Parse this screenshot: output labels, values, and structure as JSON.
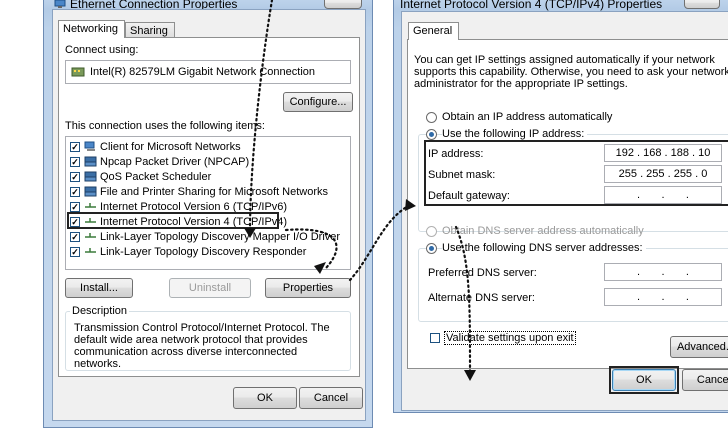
{
  "left_dialog": {
    "title": "Ethernet Connection Properties",
    "tabs": [
      "Networking",
      "Sharing"
    ],
    "connect_using_label": "Connect using:",
    "adapter_name": "Intel(R) 82579LM Gigabit Network Connection",
    "configure_label": "Configure...",
    "items_label": "This connection uses the following items:",
    "items": [
      {
        "label": "Client for Microsoft Networks",
        "checked": true,
        "icon": "network-client-icon"
      },
      {
        "label": "Npcap Packet Driver (NPCAP)",
        "checked": true,
        "icon": "network-service-icon"
      },
      {
        "label": "QoS Packet Scheduler",
        "checked": true,
        "icon": "network-service-icon"
      },
      {
        "label": "File and Printer Sharing for Microsoft Networks",
        "checked": true,
        "icon": "network-service-icon"
      },
      {
        "label": "Internet Protocol Version 6 (TCP/IPv6)",
        "checked": true,
        "icon": "protocol-icon"
      },
      {
        "label": "Internet Protocol Version 4 (TCP/IPv4)",
        "checked": true,
        "icon": "protocol-icon"
      },
      {
        "label": "Link-Layer Topology Discovery Mapper I/O Driver",
        "checked": true,
        "icon": "protocol-icon"
      },
      {
        "label": "Link-Layer Topology Discovery Responder",
        "checked": true,
        "icon": "protocol-icon"
      }
    ],
    "install_label": "Install...",
    "uninstall_label": "Uninstall",
    "properties_label": "Properties",
    "description_heading": "Description",
    "description_text": "Transmission Control Protocol/Internet Protocol. The default wide area network protocol that provides communication across diverse interconnected networks.",
    "ok_label": "OK",
    "cancel_label": "Cancel"
  },
  "right_dialog": {
    "title": "Internet Protocol Version 4 (TCP/IPv4) Properties",
    "tab": "General",
    "intro_text": "You can get IP settings assigned automatically if your network supports this capability. Otherwise, you need to ask your network administrator for the appropriate IP settings.",
    "obtain_ip_auto": "Obtain an IP address automatically",
    "use_following_ip": "Use the following IP address:",
    "ip_address_label": "IP address:",
    "ip_address_value": "192 . 168 . 188 . 10",
    "subnet_label": "Subnet mask:",
    "subnet_value": "255 . 255 . 255 . 0",
    "gateway_label": "Default gateway:",
    "gateway_value": ".       .       .",
    "obtain_dns_auto": "Obtain DNS server address automatically",
    "use_following_dns": "Use the following DNS server addresses:",
    "preferred_dns_label": "Preferred DNS server:",
    "preferred_dns_value": ".       .       .",
    "alternate_dns_label": "Alternate DNS server:",
    "alternate_dns_value": ".       .       .",
    "validate_label": "Validate settings upon exit",
    "advanced_label": "Advanced...",
    "ok_label": "OK",
    "cancel_label": "Cancel"
  },
  "colors": {
    "window_frame": "#bcd2ea",
    "dialog_bg": "#f0f0f0",
    "highlight_box": "#222222",
    "arrow_dots": "#111111"
  }
}
